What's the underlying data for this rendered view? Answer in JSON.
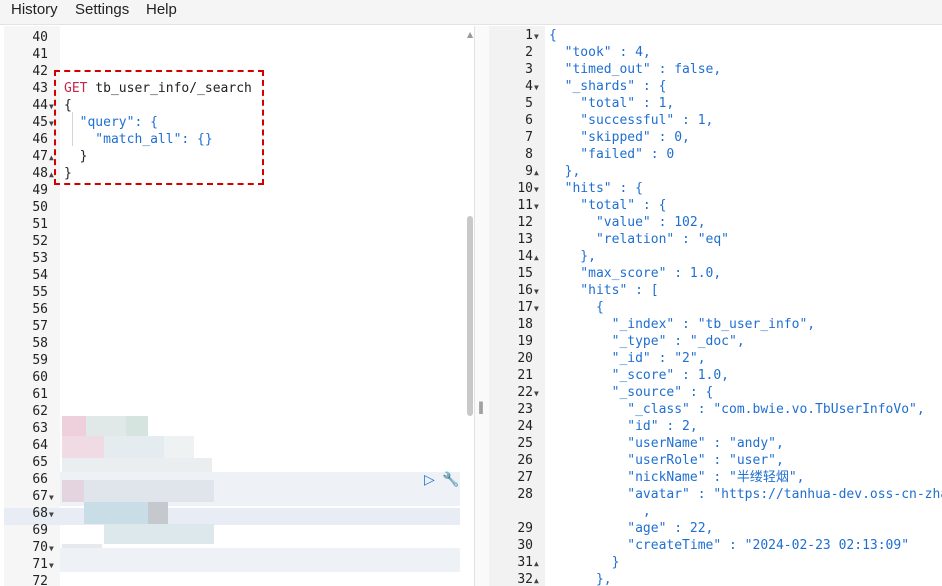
{
  "menu": {
    "history": "History",
    "settings": "Settings",
    "help": "Help"
  },
  "request": {
    "lines": [
      {
        "n": "40",
        "t": ""
      },
      {
        "n": "41",
        "t": ""
      },
      {
        "n": "42",
        "t": ""
      },
      {
        "n": "43",
        "t": "GET tb_user_info/_search"
      },
      {
        "n": "44",
        "t": "{"
      },
      {
        "n": "45",
        "t": "  \"query\": {"
      },
      {
        "n": "46",
        "t": "    \"match_all\": {}"
      },
      {
        "n": "47",
        "t": "  }"
      },
      {
        "n": "48",
        "t": "}"
      },
      {
        "n": "49",
        "t": ""
      },
      {
        "n": "50",
        "t": ""
      },
      {
        "n": "51",
        "t": ""
      },
      {
        "n": "52",
        "t": ""
      },
      {
        "n": "53",
        "t": ""
      },
      {
        "n": "54",
        "t": ""
      },
      {
        "n": "55",
        "t": ""
      },
      {
        "n": "56",
        "t": ""
      },
      {
        "n": "57",
        "t": ""
      },
      {
        "n": "58",
        "t": ""
      },
      {
        "n": "59",
        "t": ""
      },
      {
        "n": "60",
        "t": ""
      },
      {
        "n": "61",
        "t": ""
      },
      {
        "n": "62",
        "t": ""
      },
      {
        "n": "63",
        "t": ""
      },
      {
        "n": "64",
        "t": ""
      },
      {
        "n": "65",
        "t": ""
      },
      {
        "n": "66",
        "t": ""
      },
      {
        "n": "67",
        "t": ""
      },
      {
        "n": "68",
        "t": ""
      },
      {
        "n": "69",
        "t": ""
      },
      {
        "n": "70",
        "t": ""
      },
      {
        "n": "71",
        "t": ""
      },
      {
        "n": "72",
        "t": ""
      }
    ]
  },
  "response": {
    "lines": [
      {
        "n": "1",
        "t": "{"
      },
      {
        "n": "2",
        "t": "  \"took\" : 4,"
      },
      {
        "n": "3",
        "t": "  \"timed_out\" : false,"
      },
      {
        "n": "4",
        "t": "  \"_shards\" : {"
      },
      {
        "n": "5",
        "t": "    \"total\" : 1,"
      },
      {
        "n": "6",
        "t": "    \"successful\" : 1,"
      },
      {
        "n": "7",
        "t": "    \"skipped\" : 0,"
      },
      {
        "n": "8",
        "t": "    \"failed\" : 0"
      },
      {
        "n": "9",
        "t": "  },"
      },
      {
        "n": "10",
        "t": "  \"hits\" : {"
      },
      {
        "n": "11",
        "t": "    \"total\" : {"
      },
      {
        "n": "12",
        "t": "      \"value\" : 102,"
      },
      {
        "n": "13",
        "t": "      \"relation\" : \"eq\""
      },
      {
        "n": "14",
        "t": "    },"
      },
      {
        "n": "15",
        "t": "    \"max_score\" : 1.0,"
      },
      {
        "n": "16",
        "t": "    \"hits\" : ["
      },
      {
        "n": "17",
        "t": "      {"
      },
      {
        "n": "18",
        "t": "        \"_index\" : \"tb_user_info\","
      },
      {
        "n": "19",
        "t": "        \"_type\" : \"_doc\","
      },
      {
        "n": "20",
        "t": "        \"_id\" : \"2\","
      },
      {
        "n": "21",
        "t": "        \"_score\" : 1.0,"
      },
      {
        "n": "22",
        "t": "        \"_source\" : {"
      },
      {
        "n": "23",
        "t": "          \"_class\" : \"com.bwie.vo.TbUserInfoVo\","
      },
      {
        "n": "24",
        "t": "          \"id\" : 2,"
      },
      {
        "n": "25",
        "t": "          \"userName\" : \"andy\","
      },
      {
        "n": "26",
        "t": "          \"userRole\" : \"user\","
      },
      {
        "n": "27",
        "t": "          \"nickName\" : \"半缕轻烟\","
      },
      {
        "n": "28",
        "t": "          \"avatar\" : \"https://tanhua-dev.oss-cn-zhan"
      },
      {
        "n": "",
        "t": "            ,"
      },
      {
        "n": "29",
        "t": "          \"age\" : 22,"
      },
      {
        "n": "30",
        "t": "          \"createTime\" : \"2024-02-23 02:13:09\""
      },
      {
        "n": "31",
        "t": "        }"
      },
      {
        "n": "32",
        "t": "      },"
      }
    ]
  },
  "colors": {
    "accent": "#1f6fd1",
    "method": "#c7254e",
    "selection": "#d40000"
  },
  "icons": {
    "run": "play-icon",
    "settings": "wrench-icon"
  }
}
